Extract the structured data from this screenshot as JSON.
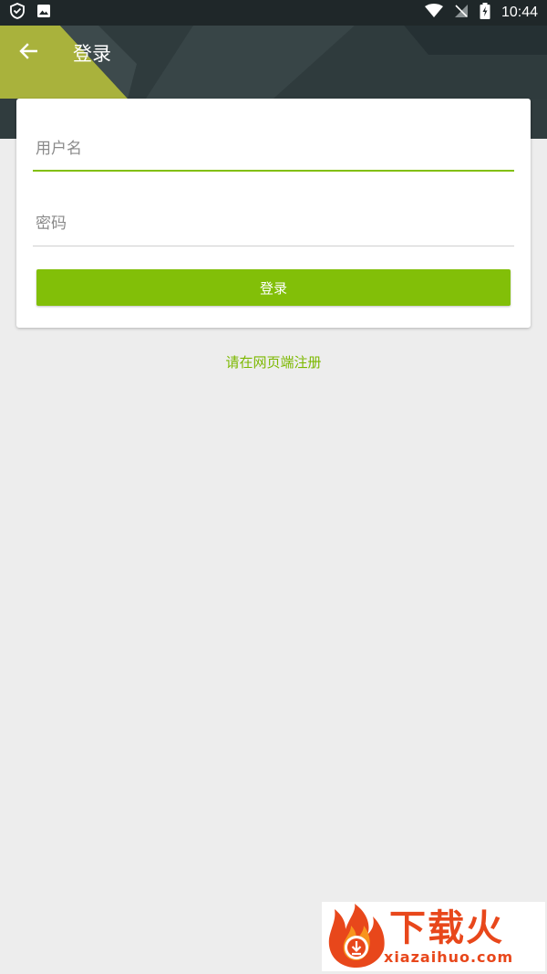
{
  "status_bar": {
    "time": "10:44",
    "left_icons": [
      "shield-icon",
      "image-icon"
    ],
    "right_icons": [
      "wifi-icon",
      "no-signal-icon",
      "battery-charging-icon"
    ]
  },
  "app_bar": {
    "back_icon": "arrow-left-icon",
    "title": "登录"
  },
  "login_form": {
    "username_placeholder": "用户名",
    "username_value": "",
    "password_placeholder": "密码",
    "password_value": "",
    "submit_label": "登录"
  },
  "register_link": "请在网页端注册",
  "watermark": {
    "brand_cn": "下载火",
    "brand_en": "xiazaihuo.com"
  },
  "colors": {
    "accent": "#82bf08",
    "header_dark": "#2e3a3c",
    "header_olive": "#a6b03a",
    "background": "#ededed",
    "watermark": "#e8471b"
  }
}
